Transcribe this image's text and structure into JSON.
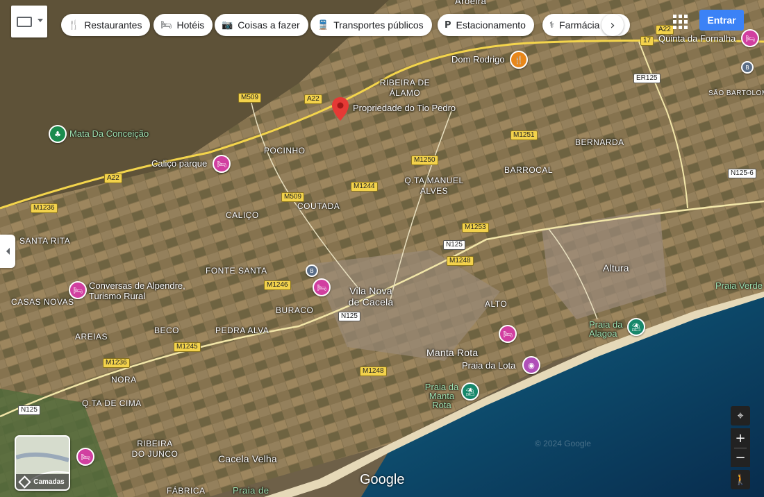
{
  "top_bar": {
    "chips": [
      {
        "icon": "restaurant-icon",
        "glyph": "🍴",
        "label": "Restaurantes"
      },
      {
        "icon": "hotel-icon",
        "glyph": "🛏",
        "label": "Hotéis"
      },
      {
        "icon": "camera-icon",
        "glyph": "📷",
        "label": "Coisas a fazer"
      },
      {
        "icon": "transit-icon",
        "glyph": "🚆",
        "label": "Transportes públicos"
      },
      {
        "icon": "parking-icon",
        "glyph": "P",
        "label": "Estacionamento"
      },
      {
        "icon": "pharmacy-icon",
        "glyph": "⚕",
        "label": "Farmácia"
      }
    ],
    "more_glyph": "›",
    "apps_glyph": "⋮⋮⋮",
    "signin_label": "Entrar"
  },
  "marker": {
    "label": "Propriedade do Tio Pedro",
    "color": "#e53935"
  },
  "pois": [
    {
      "name": "Dom Rodrigo",
      "type": "food"
    },
    {
      "name": "Quinta da Fornalha",
      "type": "hotel"
    },
    {
      "name": "Mata Da Conceição",
      "type": "park"
    },
    {
      "name": "Caliço parque",
      "type": "hotel"
    },
    {
      "name": "Conversas de Alpendre, Turismo Rural",
      "type": "hotel"
    },
    {
      "name": "Praia da Alagoa",
      "type": "beach"
    },
    {
      "name": "Praia da Lota",
      "type": "photo"
    },
    {
      "name": "Praia da Manta Rota",
      "type": "beach"
    }
  ],
  "places": [
    "RIBEIRA DE ÁLAMO",
    "POCINHO",
    "BERNARDA",
    "BARROCAL",
    "Q.TA MANUEL ALVES",
    "COUTADA",
    "CALIÇO",
    "SANTA RITA",
    "FONTE SANTA",
    "CASAS NOVAS",
    "BURACO",
    "BECO",
    "PEDRA ALVA",
    "AREIAS",
    "NORA",
    "Q.TA DE CIMA",
    "RIBEIRA DO JUNCO",
    "FÁBRICA",
    "ALTO",
    "SÃO BARTOLOM",
    "Aroeira",
    "Praia de"
  ],
  "towns": [
    "Vila Nova de Cacela",
    "Altura",
    "Manta Rota",
    "Cacela Velha",
    "Praia Verde"
  ],
  "roads": [
    "A22",
    "A22",
    "A22",
    "M509",
    "M509",
    "M1251",
    "M1250",
    "M1244",
    "M1253",
    "M1248",
    "M1246",
    "M1245",
    "M1236",
    "M1236",
    "M1248",
    "N125",
    "N125",
    "N125",
    "ER125",
    "N125-6",
    "17"
  ],
  "controls": {
    "layers_label": "Camadas",
    "zoom_in": "+",
    "zoom_out": "−",
    "locate_glyph": "⌖",
    "pegman_glyph": "🚶"
  },
  "attribution": {
    "logo": "Google",
    "copyright": "© 2024 Google"
  },
  "colors": {
    "accent": "#1a73e8",
    "water": "#0c3b5e",
    "sand": "#e8dcc0",
    "pin_hotel": "#d13fa0"
  }
}
